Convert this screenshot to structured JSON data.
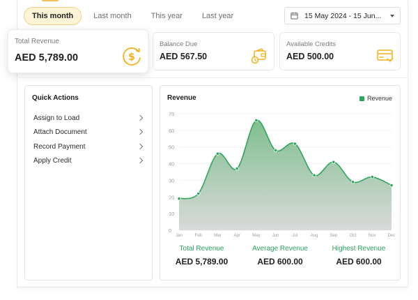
{
  "filters": {
    "tabs": [
      {
        "label": "This month",
        "active": true
      },
      {
        "label": "Last month",
        "active": false
      },
      {
        "label": "This year",
        "active": false
      },
      {
        "label": "Last year",
        "active": false
      }
    ],
    "date_range": "15 May 2024 - 15 Jun...",
    "calendar_icon": "calendar-icon",
    "dropdown_icon": "caret-down-icon"
  },
  "stats": {
    "total_revenue": {
      "label": "Total Revenue",
      "value": "AED 5,789.00",
      "icon": "dollar-cycle-icon"
    },
    "balance_due": {
      "label": "Balance Due",
      "value": "AED 567.50",
      "icon": "wallet-clock-icon"
    },
    "available_credits": {
      "label": "Available Credits",
      "value": "AED 500.00",
      "icon": "credit-card-icon"
    }
  },
  "quick_actions": {
    "title": "Quick Actions",
    "items": [
      {
        "label": "Assign to Load"
      },
      {
        "label": "Attach Document"
      },
      {
        "label": "Record Payment"
      },
      {
        "label": "Apply Credit"
      }
    ]
  },
  "revenue_panel": {
    "title": "Revenue",
    "legend_label": "Revenue",
    "summary": [
      {
        "label": "Total Revenue",
        "value": "AED 5,789.00"
      },
      {
        "label": "Average Revenue",
        "value": "AED 600.00"
      },
      {
        "label": "Highest Revenue",
        "value": "AED 600.00"
      }
    ]
  },
  "colors": {
    "accent_yellow": "#f2b11b",
    "series_green": "#2ea65b"
  },
  "chart_data": {
    "type": "area",
    "categories": [
      "Jan",
      "Feb",
      "Mar",
      "Apr",
      "May",
      "Jun",
      "Jul",
      "Aug",
      "Sep",
      "Oct",
      "Nov",
      "Dec"
    ],
    "series": [
      {
        "name": "Revenue",
        "values": [
          19,
          22,
          46,
          37,
          66,
          48,
          52,
          33,
          41,
          29,
          32,
          27
        ]
      }
    ],
    "yticks": [
      0,
      10,
      20,
      30,
      40,
      50,
      60,
      70
    ],
    "ylim": [
      0,
      70
    ],
    "grid": true,
    "legend": "top-right"
  }
}
